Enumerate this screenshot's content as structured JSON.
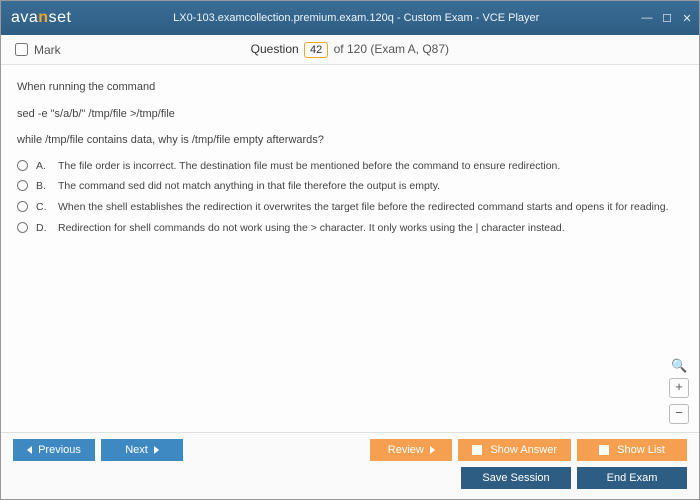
{
  "window": {
    "title": "LX0-103.examcollection.premium.exam.120q - Custom Exam - VCE Player",
    "logo_prefix": "ava",
    "logo_accent": "n",
    "logo_suffix": "set"
  },
  "header": {
    "mark_label": "Mark",
    "question_word": "Question",
    "question_number": "42",
    "of_text": " of 120 (Exam A, Q87)"
  },
  "question": {
    "line1": "When running the command",
    "line2": "sed -e \"s/a/b/\" /tmp/file >/tmp/file",
    "line3": "while /tmp/file contains data, why is /tmp/file empty afterwards?"
  },
  "answers": [
    {
      "letter": "A.",
      "text": "The file order is incorrect. The destination file must be mentioned before the command to ensure redirection."
    },
    {
      "letter": "B.",
      "text": "The command sed did not match anything in that file therefore the output is empty."
    },
    {
      "letter": "C.",
      "text": "When the shell establishes the redirection it overwrites the target file before the redirected command starts and opens it for reading."
    },
    {
      "letter": "D.",
      "text": "Redirection for shell commands do not work using the > character. It only works using the | character instead."
    }
  ],
  "zoom": {
    "plus": "+",
    "minus": "−",
    "mag": "🔍"
  },
  "footer": {
    "previous": "Previous",
    "next": "Next",
    "review": "Review",
    "show_answer": "Show Answer",
    "show_list": "Show List",
    "save_session": "Save Session",
    "end_exam": "End Exam"
  }
}
